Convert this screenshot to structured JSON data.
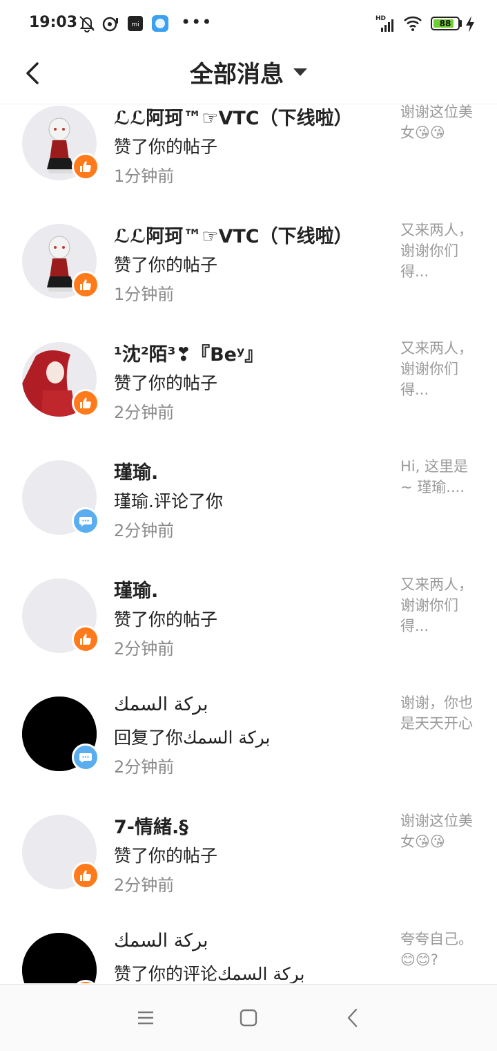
{
  "status_bar": {
    "time": "19:03",
    "dots": "•••",
    "network": "HD",
    "battery": "88",
    "battery_level": 0.88,
    "battery_color": "#6fcf2f"
  },
  "header": {
    "title": "全部消息"
  },
  "colors": {
    "like_badge": "#ff7a1a",
    "comment_badge": "#5aaef0"
  },
  "messages": [
    {
      "name": "ℒℒ阿珂™☞VTC（下线啦）",
      "action": "赞了你的帖子",
      "time": "1分钟前",
      "snippet": "谢谢这位美女😘😘",
      "badge": "like-icon"
    },
    {
      "name": "ℒℒ阿珂™☞VTC（下线啦）",
      "action": "赞了你的帖子",
      "time": "1分钟前",
      "snippet": "又来两人，谢谢你们得...",
      "badge": "like-icon"
    },
    {
      "name": "¹沈²陌³❣『Beʸ』",
      "action": "赞了你的帖子",
      "time": "2分钟前",
      "snippet": "又来两人，谢谢你们得...",
      "badge": "like-icon"
    },
    {
      "name": "瑾瑜.",
      "action": "瑾瑜.评论了你",
      "time": "2分钟前",
      "snippet": "Hi, 这里是 ~ 瑾瑜....",
      "badge": "comment-icon"
    },
    {
      "name": "瑾瑜.",
      "action": "赞了你的帖子",
      "time": "2分钟前",
      "snippet": "又来两人，谢谢你们得...",
      "badge": "like-icon"
    },
    {
      "name": "بركة السمك",
      "action": "回复了你بركة السمك",
      "time": "2分钟前",
      "snippet": "谢谢，你也是天天开心",
      "badge": "comment-icon"
    },
    {
      "name": "7-情緒.§",
      "action": "赞了你的帖子",
      "time": "2分钟前",
      "snippet": "谢谢这位美女😘😘",
      "badge": "like-icon"
    },
    {
      "name": "بركة السمك",
      "action": "赞了你的评论بركة السمك",
      "time": "",
      "snippet": "夸夸自己。😊😊?",
      "badge": "like-icon"
    }
  ]
}
